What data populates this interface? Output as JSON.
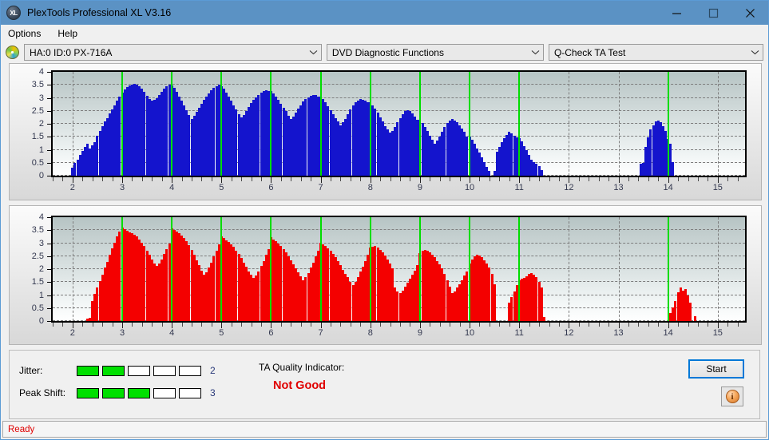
{
  "window": {
    "title": "PlexTools Professional XL V3.16",
    "icon": "disc-xl-icon",
    "minimize_label": "minimize-icon",
    "maximize_label": "maximize-icon",
    "close_label": "close-icon"
  },
  "menu": {
    "items": [
      {
        "label": "Options"
      },
      {
        "label": "Help"
      }
    ]
  },
  "toolbar": {
    "drive_icon": "disc-icon",
    "drive": {
      "value": "HA:0 ID:0  PX-716A"
    },
    "function": {
      "value": "DVD Diagnostic Functions"
    },
    "test": {
      "value": "Q-Check TA Test"
    }
  },
  "charts": [
    {
      "name": "jitter-chart",
      "color": "#1414cd"
    },
    {
      "name": "peak-shift-chart",
      "color": "#f40000"
    }
  ],
  "chart_data": [
    {
      "type": "bar",
      "title": "",
      "xlabel": "",
      "ylabel": "",
      "color": "#1414cd",
      "xlim": [
        1.6,
        15.55
      ],
      "ylim": [
        0,
        4
      ],
      "yticks": [
        0,
        0.5,
        1,
        1.5,
        2,
        2.5,
        3,
        3.5,
        4
      ],
      "ytick_labels": [
        "0",
        "0.5",
        "1",
        "1.5",
        "2",
        "2.5",
        "3",
        "3.5",
        "4"
      ],
      "xticks": [
        2,
        3,
        4,
        5,
        6,
        7,
        8,
        9,
        10,
        11,
        12,
        13,
        14,
        15
      ],
      "xtick_labels": [
        "2",
        "3",
        "4",
        "5",
        "6",
        "7",
        "8",
        "9",
        "10",
        "11",
        "12",
        "13",
        "14",
        "15"
      ],
      "grid": true,
      "markers": [
        3,
        4,
        5,
        6,
        7,
        8,
        9,
        10,
        11,
        14
      ],
      "x": [
        2.0,
        2.05,
        2.1,
        2.15,
        2.2,
        2.25,
        2.3,
        2.35,
        2.4,
        2.45,
        2.5,
        2.55,
        2.6,
        2.65,
        2.7,
        2.75,
        2.8,
        2.85,
        2.9,
        2.95,
        3.0,
        3.05,
        3.1,
        3.15,
        3.2,
        3.25,
        3.3,
        3.35,
        3.4,
        3.45,
        3.5,
        3.55,
        3.6,
        3.65,
        3.7,
        3.75,
        3.8,
        3.85,
        3.9,
        3.95,
        4.0,
        4.05,
        4.1,
        4.15,
        4.2,
        4.25,
        4.3,
        4.35,
        4.4,
        4.45,
        4.5,
        4.55,
        4.6,
        4.65,
        4.7,
        4.75,
        4.8,
        4.85,
        4.9,
        4.95,
        5.0,
        5.05,
        5.1,
        5.15,
        5.2,
        5.25,
        5.3,
        5.35,
        5.4,
        5.45,
        5.5,
        5.55,
        5.6,
        5.65,
        5.7,
        5.75,
        5.8,
        5.85,
        5.9,
        5.95,
        6.0,
        6.05,
        6.1,
        6.15,
        6.2,
        6.25,
        6.3,
        6.35,
        6.4,
        6.45,
        6.5,
        6.55,
        6.6,
        6.65,
        6.7,
        6.75,
        6.8,
        6.85,
        6.9,
        6.95,
        7.0,
        7.05,
        7.1,
        7.15,
        7.2,
        7.25,
        7.3,
        7.35,
        7.4,
        7.45,
        7.5,
        7.55,
        7.6,
        7.65,
        7.7,
        7.75,
        7.8,
        7.85,
        7.9,
        7.95,
        8.0,
        8.05,
        8.1,
        8.15,
        8.2,
        8.25,
        8.3,
        8.35,
        8.4,
        8.45,
        8.5,
        8.55,
        8.6,
        8.65,
        8.7,
        8.75,
        8.8,
        8.85,
        8.9,
        8.95,
        9.0,
        9.05,
        9.1,
        9.15,
        9.2,
        9.25,
        9.3,
        9.35,
        9.4,
        9.45,
        9.5,
        9.55,
        9.6,
        9.65,
        9.7,
        9.75,
        9.8,
        9.85,
        9.9,
        9.95,
        10.0,
        10.05,
        10.1,
        10.15,
        10.2,
        10.25,
        10.3,
        10.35,
        10.4,
        10.45,
        10.5,
        10.55,
        10.6,
        10.65,
        10.7,
        10.75,
        10.8,
        10.85,
        10.9,
        10.95,
        11.0,
        11.05,
        11.1,
        11.15,
        11.2,
        11.25,
        11.3,
        11.35,
        11.4,
        11.45,
        13.45,
        13.5,
        13.55,
        13.6,
        13.65,
        13.7,
        13.75,
        13.8,
        13.85,
        13.9,
        13.95,
        14.0,
        14.05,
        14.1
      ],
      "values": [
        0.3,
        0.48,
        0.62,
        0.8,
        0.95,
        1.1,
        1.22,
        1.05,
        1.18,
        1.3,
        1.55,
        1.72,
        1.9,
        2.08,
        2.22,
        2.4,
        2.55,
        2.72,
        2.88,
        3.05,
        3.2,
        3.32,
        3.42,
        3.48,
        3.52,
        3.55,
        3.52,
        3.45,
        3.35,
        3.22,
        3.08,
        2.95,
        2.88,
        2.92,
        3.0,
        3.1,
        3.22,
        3.35,
        3.45,
        3.5,
        3.48,
        3.38,
        3.22,
        3.05,
        2.88,
        2.7,
        2.52,
        2.35,
        2.2,
        2.3,
        2.45,
        2.62,
        2.78,
        2.92,
        3.05,
        3.18,
        3.28,
        3.38,
        3.45,
        3.5,
        3.45,
        3.35,
        3.2,
        3.05,
        2.9,
        2.72,
        2.55,
        2.38,
        2.25,
        2.35,
        2.5,
        2.65,
        2.8,
        2.92,
        3.02,
        3.12,
        3.2,
        3.25,
        3.28,
        3.25,
        3.25,
        3.18,
        3.05,
        2.92,
        2.78,
        2.62,
        2.48,
        2.32,
        2.18,
        2.28,
        2.42,
        2.58,
        2.72,
        2.85,
        2.95,
        3.02,
        3.08,
        3.12,
        3.1,
        3.05,
        3.05,
        2.95,
        2.82,
        2.68,
        2.52,
        2.38,
        2.22,
        2.08,
        1.95,
        2.05,
        2.2,
        2.38,
        2.55,
        2.7,
        2.82,
        2.9,
        2.95,
        2.92,
        2.88,
        2.82,
        2.82,
        2.72,
        2.58,
        2.42,
        2.25,
        2.08,
        1.92,
        1.78,
        1.65,
        1.72,
        1.88,
        2.05,
        2.22,
        2.38,
        2.48,
        2.52,
        2.48,
        2.4,
        2.28,
        2.15,
        2.15,
        2.02,
        1.88,
        1.72,
        1.55,
        1.38,
        1.22,
        1.35,
        1.52,
        1.7,
        1.88,
        2.02,
        2.12,
        2.18,
        2.12,
        2.05,
        1.95,
        1.82,
        1.68,
        1.52,
        1.52,
        1.38,
        1.22,
        1.05,
        0.88,
        0.7,
        0.52,
        0.35,
        0.18,
        0.0,
        0.18,
        0.92,
        1.1,
        1.28,
        1.45,
        1.58,
        1.68,
        1.62,
        1.55,
        1.48,
        1.45,
        1.32,
        1.15,
        0.98,
        0.8,
        0.62,
        0.52,
        0.45,
        0.38,
        0.22,
        0.45,
        0.48,
        1.12,
        1.48,
        1.78,
        1.95,
        2.08,
        2.12,
        2.05,
        1.92,
        1.72,
        1.42,
        1.22,
        0.52
      ],
      "bar_color": "#1414cd"
    },
    {
      "type": "bar",
      "title": "",
      "xlabel": "",
      "ylabel": "",
      "color": "#f40000",
      "xlim": [
        1.6,
        15.55
      ],
      "ylim": [
        0,
        4
      ],
      "yticks": [
        0,
        0.5,
        1,
        1.5,
        2,
        2.5,
        3,
        3.5,
        4
      ],
      "ytick_labels": [
        "0",
        "0.5",
        "1",
        "1.5",
        "2",
        "2.5",
        "3",
        "3.5",
        "4"
      ],
      "xticks": [
        2,
        3,
        4,
        5,
        6,
        7,
        8,
        9,
        10,
        11,
        12,
        13,
        14,
        15
      ],
      "xtick_labels": [
        "2",
        "3",
        "4",
        "5",
        "6",
        "7",
        "8",
        "9",
        "10",
        "11",
        "12",
        "13",
        "14",
        "15"
      ],
      "grid": true,
      "markers": [
        3,
        4,
        5,
        6,
        7,
        8,
        9,
        10,
        11,
        14
      ],
      "x": [
        2.3,
        2.35,
        2.4,
        2.45,
        2.5,
        2.55,
        2.6,
        2.65,
        2.7,
        2.75,
        2.8,
        2.85,
        2.9,
        2.95,
        3.0,
        3.05,
        3.1,
        3.15,
        3.2,
        3.25,
        3.3,
        3.35,
        3.4,
        3.45,
        3.5,
        3.55,
        3.6,
        3.65,
        3.7,
        3.75,
        3.8,
        3.85,
        3.9,
        3.95,
        4.0,
        4.05,
        4.1,
        4.15,
        4.2,
        4.25,
        4.3,
        4.35,
        4.4,
        4.45,
        4.5,
        4.55,
        4.6,
        4.65,
        4.7,
        4.75,
        4.8,
        4.85,
        4.9,
        4.95,
        5.0,
        5.05,
        5.1,
        5.15,
        5.2,
        5.25,
        5.3,
        5.35,
        5.4,
        5.45,
        5.5,
        5.55,
        5.6,
        5.65,
        5.7,
        5.75,
        5.8,
        5.85,
        5.9,
        5.95,
        6.0,
        6.05,
        6.1,
        6.15,
        6.2,
        6.25,
        6.3,
        6.35,
        6.4,
        6.45,
        6.5,
        6.55,
        6.6,
        6.65,
        6.7,
        6.75,
        6.8,
        6.85,
        6.9,
        6.95,
        7.0,
        7.05,
        7.1,
        7.15,
        7.2,
        7.25,
        7.3,
        7.35,
        7.4,
        7.45,
        7.5,
        7.55,
        7.6,
        7.65,
        7.7,
        7.75,
        7.8,
        7.85,
        7.9,
        7.95,
        8.0,
        8.05,
        8.1,
        8.15,
        8.2,
        8.25,
        8.3,
        8.35,
        8.4,
        8.45,
        8.5,
        8.55,
        8.6,
        8.65,
        8.7,
        8.75,
        8.8,
        8.85,
        8.9,
        8.95,
        9.0,
        9.05,
        9.1,
        9.15,
        9.2,
        9.25,
        9.3,
        9.35,
        9.4,
        9.45,
        9.5,
        9.55,
        9.6,
        9.65,
        9.7,
        9.75,
        9.8,
        9.85,
        9.9,
        9.95,
        10.0,
        10.05,
        10.1,
        10.15,
        10.2,
        10.25,
        10.3,
        10.35,
        10.4,
        10.45,
        10.5,
        10.8,
        10.85,
        10.9,
        10.95,
        11.0,
        11.05,
        11.1,
        11.15,
        11.2,
        11.25,
        11.3,
        11.35,
        11.4,
        11.45,
        11.5,
        14.05,
        14.1,
        14.15,
        14.2,
        14.25,
        14.3,
        14.35,
        14.4,
        14.45,
        14.55
      ],
      "values": [
        0.08,
        0.12,
        0.78,
        1.05,
        1.3,
        1.55,
        1.78,
        2.05,
        2.28,
        2.55,
        2.8,
        3.02,
        3.25,
        3.45,
        3.6,
        3.55,
        3.48,
        3.42,
        3.38,
        3.32,
        3.25,
        3.15,
        3.02,
        2.88,
        2.72,
        2.55,
        2.38,
        2.22,
        2.12,
        2.22,
        2.38,
        2.58,
        2.78,
        3.0,
        3.58,
        3.52,
        3.45,
        3.38,
        3.3,
        3.2,
        3.08,
        2.92,
        2.75,
        2.55,
        2.35,
        2.15,
        1.95,
        1.78,
        1.88,
        2.05,
        2.25,
        2.48,
        2.72,
        2.95,
        3.25,
        3.2,
        3.12,
        3.05,
        2.95,
        2.85,
        2.72,
        2.58,
        2.42,
        2.25,
        2.08,
        1.92,
        1.78,
        1.65,
        1.75,
        1.92,
        2.12,
        2.32,
        2.55,
        2.78,
        3.22,
        3.15,
        3.08,
        3.0,
        2.9,
        2.78,
        2.65,
        2.5,
        2.35,
        2.18,
        2.02,
        1.88,
        1.72,
        1.58,
        1.68,
        1.85,
        2.05,
        2.25,
        2.48,
        2.7,
        3.02,
        2.95,
        2.88,
        2.8,
        2.7,
        2.58,
        2.45,
        2.3,
        2.15,
        1.98,
        1.82,
        1.68,
        1.52,
        1.4,
        1.52,
        1.7,
        1.9,
        2.1,
        2.32,
        2.55,
        2.82,
        2.85,
        2.88,
        2.82,
        2.75,
        2.65,
        2.52,
        2.38,
        2.22,
        2.02,
        1.28,
        1.15,
        1.08,
        1.18,
        1.32,
        1.48,
        1.62,
        1.78,
        1.95,
        2.15,
        2.62,
        2.7,
        2.75,
        2.72,
        2.65,
        2.55,
        2.45,
        2.32,
        2.18,
        2.02,
        1.82,
        1.58,
        1.32,
        1.08,
        1.15,
        1.28,
        1.42,
        1.58,
        1.75,
        1.92,
        2.22,
        2.38,
        2.5,
        2.55,
        2.52,
        2.45,
        2.35,
        2.22,
        2.05,
        1.82,
        1.42,
        0.7,
        0.92,
        1.15,
        1.38,
        1.58,
        1.62,
        1.65,
        1.72,
        1.82,
        1.85,
        1.78,
        1.68,
        1.52,
        1.28,
        0.15,
        0.32,
        0.52,
        0.78,
        1.12,
        1.28,
        1.18,
        1.22,
        0.98,
        0.72,
        0.18
      ],
      "bar_color": "#f40000"
    }
  ],
  "results": {
    "jitter": {
      "label": "Jitter:",
      "filled": 2,
      "total": 5,
      "value": "2"
    },
    "peak_shift": {
      "label": "Peak Shift:",
      "filled": 3,
      "total": 5,
      "value": "3"
    },
    "ta_quality": {
      "label": "TA Quality Indicator:",
      "value": "Not Good",
      "color": "#e00000"
    }
  },
  "actions": {
    "start_label": "Start",
    "info_label": "i"
  },
  "statusbar": {
    "text": "Ready"
  }
}
